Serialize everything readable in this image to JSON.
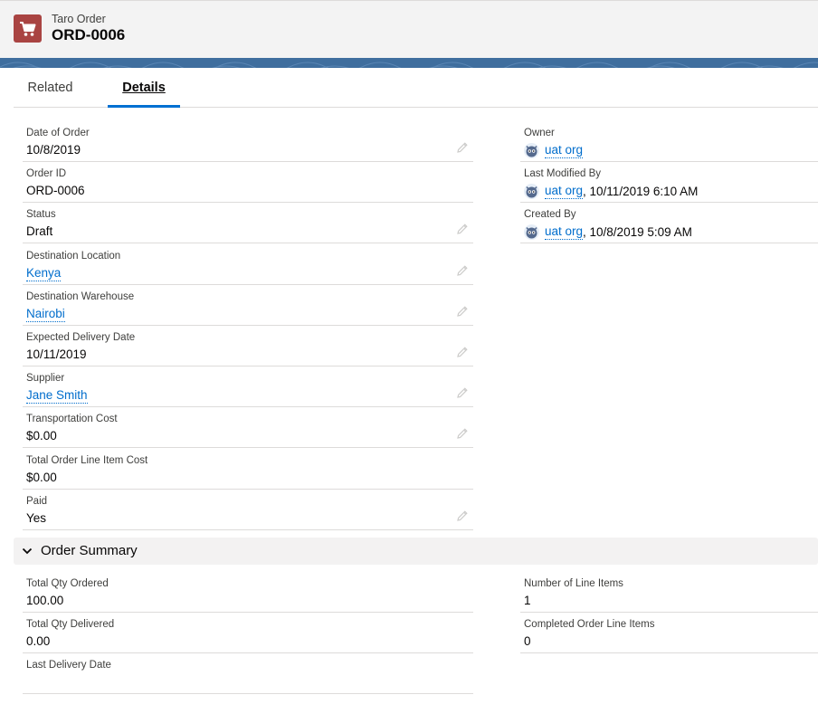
{
  "record": {
    "object_type": "Taro Order",
    "name": "ORD-0006"
  },
  "tabs": [
    {
      "label": "Related"
    },
    {
      "label": "Details"
    }
  ],
  "left_fields": [
    {
      "label": "Date of Order",
      "value": "10/8/2019",
      "link": false,
      "editable": true
    },
    {
      "label": "Order ID",
      "value": "ORD-0006",
      "link": false,
      "editable": false
    },
    {
      "label": "Status",
      "value": "Draft",
      "link": false,
      "editable": true
    },
    {
      "label": "Destination Location",
      "value": "Kenya",
      "link": true,
      "editable": true
    },
    {
      "label": "Destination Warehouse",
      "value": "Nairobi",
      "link": true,
      "editable": true
    },
    {
      "label": "Expected Delivery Date",
      "value": "10/11/2019",
      "link": false,
      "editable": true
    },
    {
      "label": "Supplier",
      "value": "Jane Smith",
      "link": true,
      "editable": true
    },
    {
      "label": "Transportation Cost",
      "value": "$0.00",
      "link": false,
      "editable": true
    },
    {
      "label": "Total Order Line Item Cost",
      "value": "$0.00",
      "link": false,
      "editable": false
    },
    {
      "label": "Paid",
      "value": "Yes",
      "link": false,
      "editable": true
    }
  ],
  "right_fields": [
    {
      "label": "Owner",
      "user": "uat org",
      "suffix": ""
    },
    {
      "label": "Last Modified By",
      "user": "uat org",
      "suffix": ", 10/11/2019 6:10 AM"
    },
    {
      "label": "Created By",
      "user": "uat org",
      "suffix": ", 10/8/2019 5:09 AM"
    }
  ],
  "order_summary": {
    "title": "Order Summary",
    "left": [
      {
        "label": "Total Qty Ordered",
        "value": "100.00"
      },
      {
        "label": "Total Qty Delivered",
        "value": "0.00"
      },
      {
        "label": "Last Delivery Date",
        "value": ""
      }
    ],
    "right": [
      {
        "label": "Number of Line Items",
        "value": "1"
      },
      {
        "label": "Completed Order Line Items",
        "value": "0"
      }
    ]
  },
  "colors": {
    "object_icon": "#a94442",
    "link": "#006dcc",
    "active_tab": "#0070d2",
    "banner": "#3f6e9e"
  },
  "icons": {
    "object": "cart-icon",
    "edit": "pencil-icon",
    "user": "user-avatar-icon",
    "section": "chevron-down-icon"
  }
}
